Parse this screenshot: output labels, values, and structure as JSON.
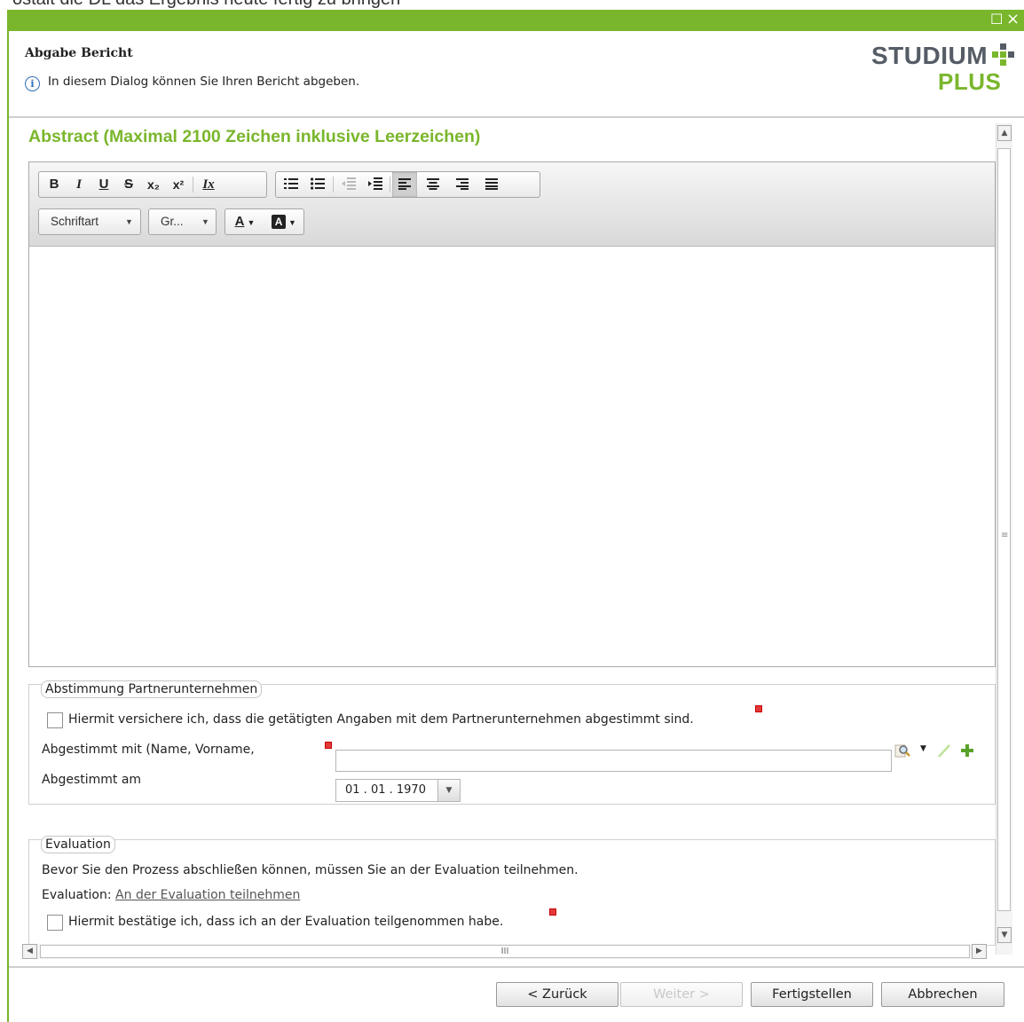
{
  "background_text": "ostalt die DL das Ergebnis heute fertig zu bringen",
  "window": {
    "maximize_glyph": "☐",
    "close_glyph": "×"
  },
  "header": {
    "title": "Abgabe Bericht",
    "info_text": "In diesem Dialog können Sie Ihren Bericht abgeben.",
    "logo_line1": "STUDIUM",
    "logo_line2": "PLUS"
  },
  "abstract": {
    "title": "Abstract (Maximal 2100 Zeichen inklusive Leerzeichen)",
    "toolbar_buttons": [
      "B",
      "I",
      "U",
      "S",
      "x₂",
      "x²",
      "Ix"
    ],
    "font_label": "Schriftart",
    "size_label": "Gr...",
    "text_color_glyph": "A",
    "bg_color_glyph": "A",
    "content": ""
  },
  "partner": {
    "legend": "Abstimmung Partnerunternehmen",
    "confirm_text": "Hiermit versichere ich, dass die getätigten Angaben mit dem Partnerunternehmen abgestimmt sind.",
    "agreed_with_label": "Abgestimmt mit (Name, Vorname,",
    "agreed_with_value": "",
    "agreed_on_label": "Abgestimmt am",
    "agreed_on_value": "01 . 01 . 1970"
  },
  "evaluation": {
    "legend": "Evaluation",
    "note": "Bevor Sie den Prozess abschließen können, müssen Sie an der Evaluation teilnehmen.",
    "link_prefix": "Evaluation:",
    "link_text": "An der Evaluation teilnehmen",
    "confirm_text": "Hiermit bestätige ich, dass ich an der Evaluation teilgenommen habe."
  },
  "scrollbar": {
    "grip_glyph": "≡",
    "h_grip_glyph": "III"
  },
  "footer": {
    "back": "< Zurück",
    "next": "Weiter >",
    "finish": "Fertigstellen",
    "cancel": "Abbrechen"
  },
  "colors": {
    "accent_green": "#7ab62c",
    "logo_gray": "#555c66",
    "required_red": "#e03a3a"
  }
}
